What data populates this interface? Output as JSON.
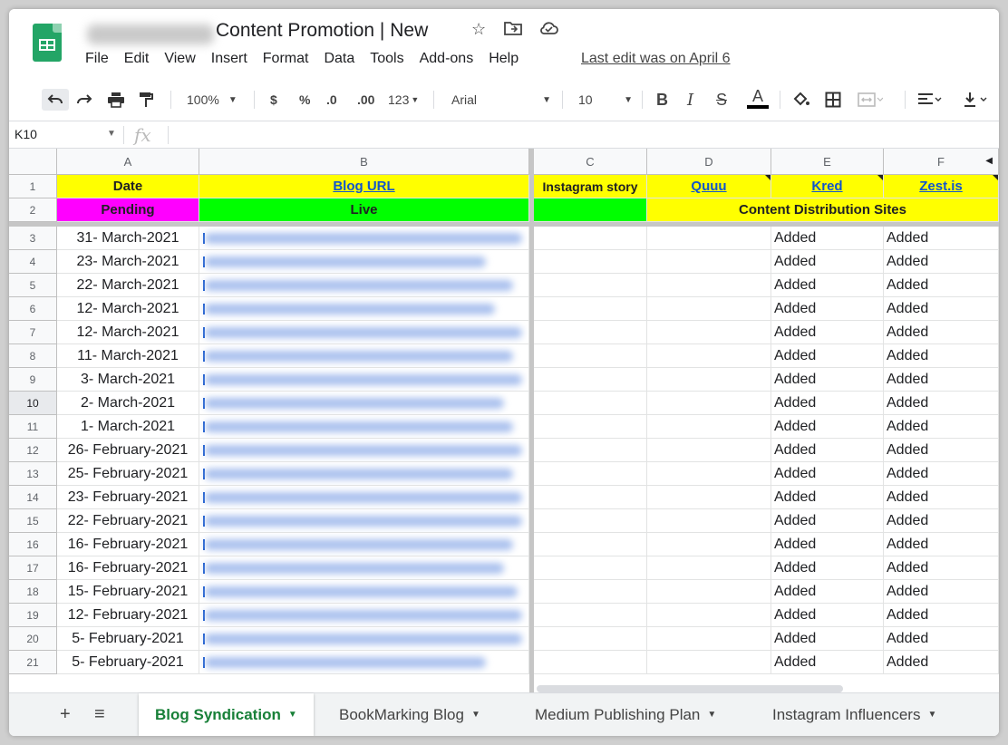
{
  "header": {
    "title": "Content Promotion | New",
    "menu": [
      "File",
      "Edit",
      "View",
      "Insert",
      "Format",
      "Data",
      "Tools",
      "Add-ons",
      "Help"
    ],
    "last_edit": "Last edit was on April 6"
  },
  "toolbar": {
    "zoom": "100%",
    "currency": "$",
    "percent": "%",
    "decrease_decimal": ".0",
    "increase_decimal": ".00",
    "more_formats": "123",
    "font": "Arial",
    "font_size": "10"
  },
  "formula_bar": {
    "cell_ref": "K10",
    "fx": "fx"
  },
  "columns": [
    "A",
    "B",
    "C",
    "D",
    "E",
    "F"
  ],
  "row1": {
    "num": "1",
    "a": "Date",
    "b": "Blog URL ",
    "c": "Instagram story",
    "d": "Quuu",
    "e": "Kred",
    "f": "Zest.is"
  },
  "row2": {
    "num": "2",
    "a": "Pending",
    "b": "Live",
    "de": "Content Distribution Sites"
  },
  "rows": [
    {
      "num": "3",
      "date": "31- March-2021",
      "e": "Added",
      "f": "Added"
    },
    {
      "num": "4",
      "date": "23- March-2021",
      "e": "Added",
      "f": "Added"
    },
    {
      "num": "5",
      "date": "22- March-2021",
      "e": "Added",
      "f": "Added"
    },
    {
      "num": "6",
      "date": "12- March-2021",
      "e": "Added",
      "f": "Added"
    },
    {
      "num": "7",
      "date": "12- March-2021",
      "e": "Added",
      "f": "Added"
    },
    {
      "num": "8",
      "date": "11- March-2021",
      "e": "Added",
      "f": "Added"
    },
    {
      "num": "9",
      "date": "3- March-2021",
      "e": "Added",
      "f": "Added"
    },
    {
      "num": "10",
      "date": "2- March-2021",
      "e": "Added",
      "f": "Added"
    },
    {
      "num": "11",
      "date": "1- March-2021",
      "e": "Added",
      "f": "Added"
    },
    {
      "num": "12",
      "date": "26- February-2021",
      "e": "Added",
      "f": "Added"
    },
    {
      "num": "13",
      "date": "25- February-2021",
      "e": "Added",
      "f": "Added"
    },
    {
      "num": "14",
      "date": "23- February-2021",
      "e": "Added",
      "f": "Added"
    },
    {
      "num": "15",
      "date": "22- February-2021",
      "e": "Added",
      "f": "Added"
    },
    {
      "num": "16",
      "date": "16- February-2021",
      "e": "Added",
      "f": "Added"
    },
    {
      "num": "17",
      "date": "16- February-2021",
      "e": "Added",
      "f": "Added"
    },
    {
      "num": "18",
      "date": "15- February-2021",
      "e": "Added",
      "f": "Added"
    },
    {
      "num": "19",
      "date": "12- February-2021",
      "e": "Added",
      "f": "Added"
    },
    {
      "num": "20",
      "date": "5- February-2021",
      "e": "Added",
      "f": "Added"
    },
    {
      "num": "21",
      "date": "5- February-2021",
      "e": "Added",
      "f": "Added"
    }
  ],
  "sheets": [
    "Blog Syndication",
    "BookMarking Blog",
    "Medium Publishing Plan",
    "Instagram Influencers"
  ],
  "colors": {
    "yellow": "#ffff00",
    "magenta": "#ff00ff",
    "green": "#00ff00",
    "link": "#1155cc",
    "active_tab": "#188038",
    "logo": "#23a566"
  }
}
